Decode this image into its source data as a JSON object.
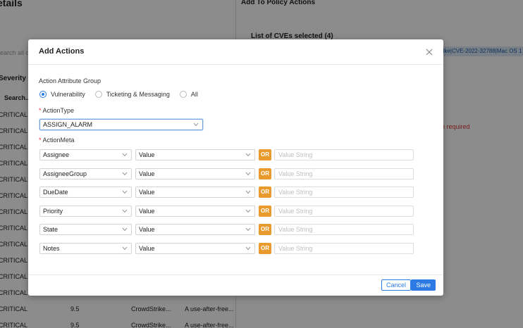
{
  "background": {
    "left_title": "etails",
    "search_placeholder": "Search all c",
    "severity_header": "Severity",
    "search_label": "Search...",
    "rows": [
      {
        "sev": "CRITICAL"
      },
      {
        "sev": "CRITICAL"
      },
      {
        "sev": "CRITICAL"
      },
      {
        "sev": "CRITICAL"
      },
      {
        "sev": "CRITICAL"
      },
      {
        "sev": "CRITICAL"
      },
      {
        "sev": "CRITICAL"
      },
      {
        "sev": "CRITICAL"
      },
      {
        "sev": "CRITICAL"
      },
      {
        "sev": "CRITICAL"
      },
      {
        "sev": "CRITICAL"
      },
      {
        "sev": "CRITICAL"
      },
      {
        "sev": "CRITICAL",
        "score": "9.5",
        "source": "CrowdStrike...",
        "desc": "A use-after-free..."
      },
      {
        "sev": "CRITICAL",
        "score": "9.5",
        "source": "CrowdStrike...",
        "desc": "A use-after-free..."
      }
    ],
    "right_title": "Add To Policy Actions",
    "cve_list_title": "List of CVEs selected (4)",
    "cve_chip": "rike|CVE-2022-32788|Mac OS 1",
    "required_text": "n required"
  },
  "modal": {
    "title": "Add Actions",
    "attr_group_label": "Action Attribute Group",
    "radio_options": [
      {
        "label": "Vulnerability",
        "checked": true
      },
      {
        "label": "Ticketing & Messaging",
        "checked": false
      },
      {
        "label": "All",
        "checked": false
      }
    ],
    "action_type_label": "ActionType",
    "action_type_value": "ASSIGN_ALARM",
    "action_meta_label": "ActionMeta",
    "meta_rows": [
      {
        "field": "Assignee",
        "type": "Value",
        "or": "OR",
        "placeholder": "Value String"
      },
      {
        "field": "AssigneeGroup",
        "type": "Value",
        "or": "OR",
        "placeholder": "Value String"
      },
      {
        "field": "DueDate",
        "type": "Value",
        "or": "OR",
        "placeholder": "Value String"
      },
      {
        "field": "Priority",
        "type": "Value",
        "or": "OR",
        "placeholder": "Value String"
      },
      {
        "field": "State",
        "type": "Value",
        "or": "OR",
        "placeholder": "Value String"
      },
      {
        "field": "Notes",
        "type": "Value",
        "or": "OR",
        "placeholder": "Value String"
      }
    ],
    "cancel_label": "Cancel",
    "save_label": "Save"
  },
  "colors": {
    "accent": "#2c7be5",
    "or_badge": "#e89a2c",
    "required": "#e33333"
  }
}
